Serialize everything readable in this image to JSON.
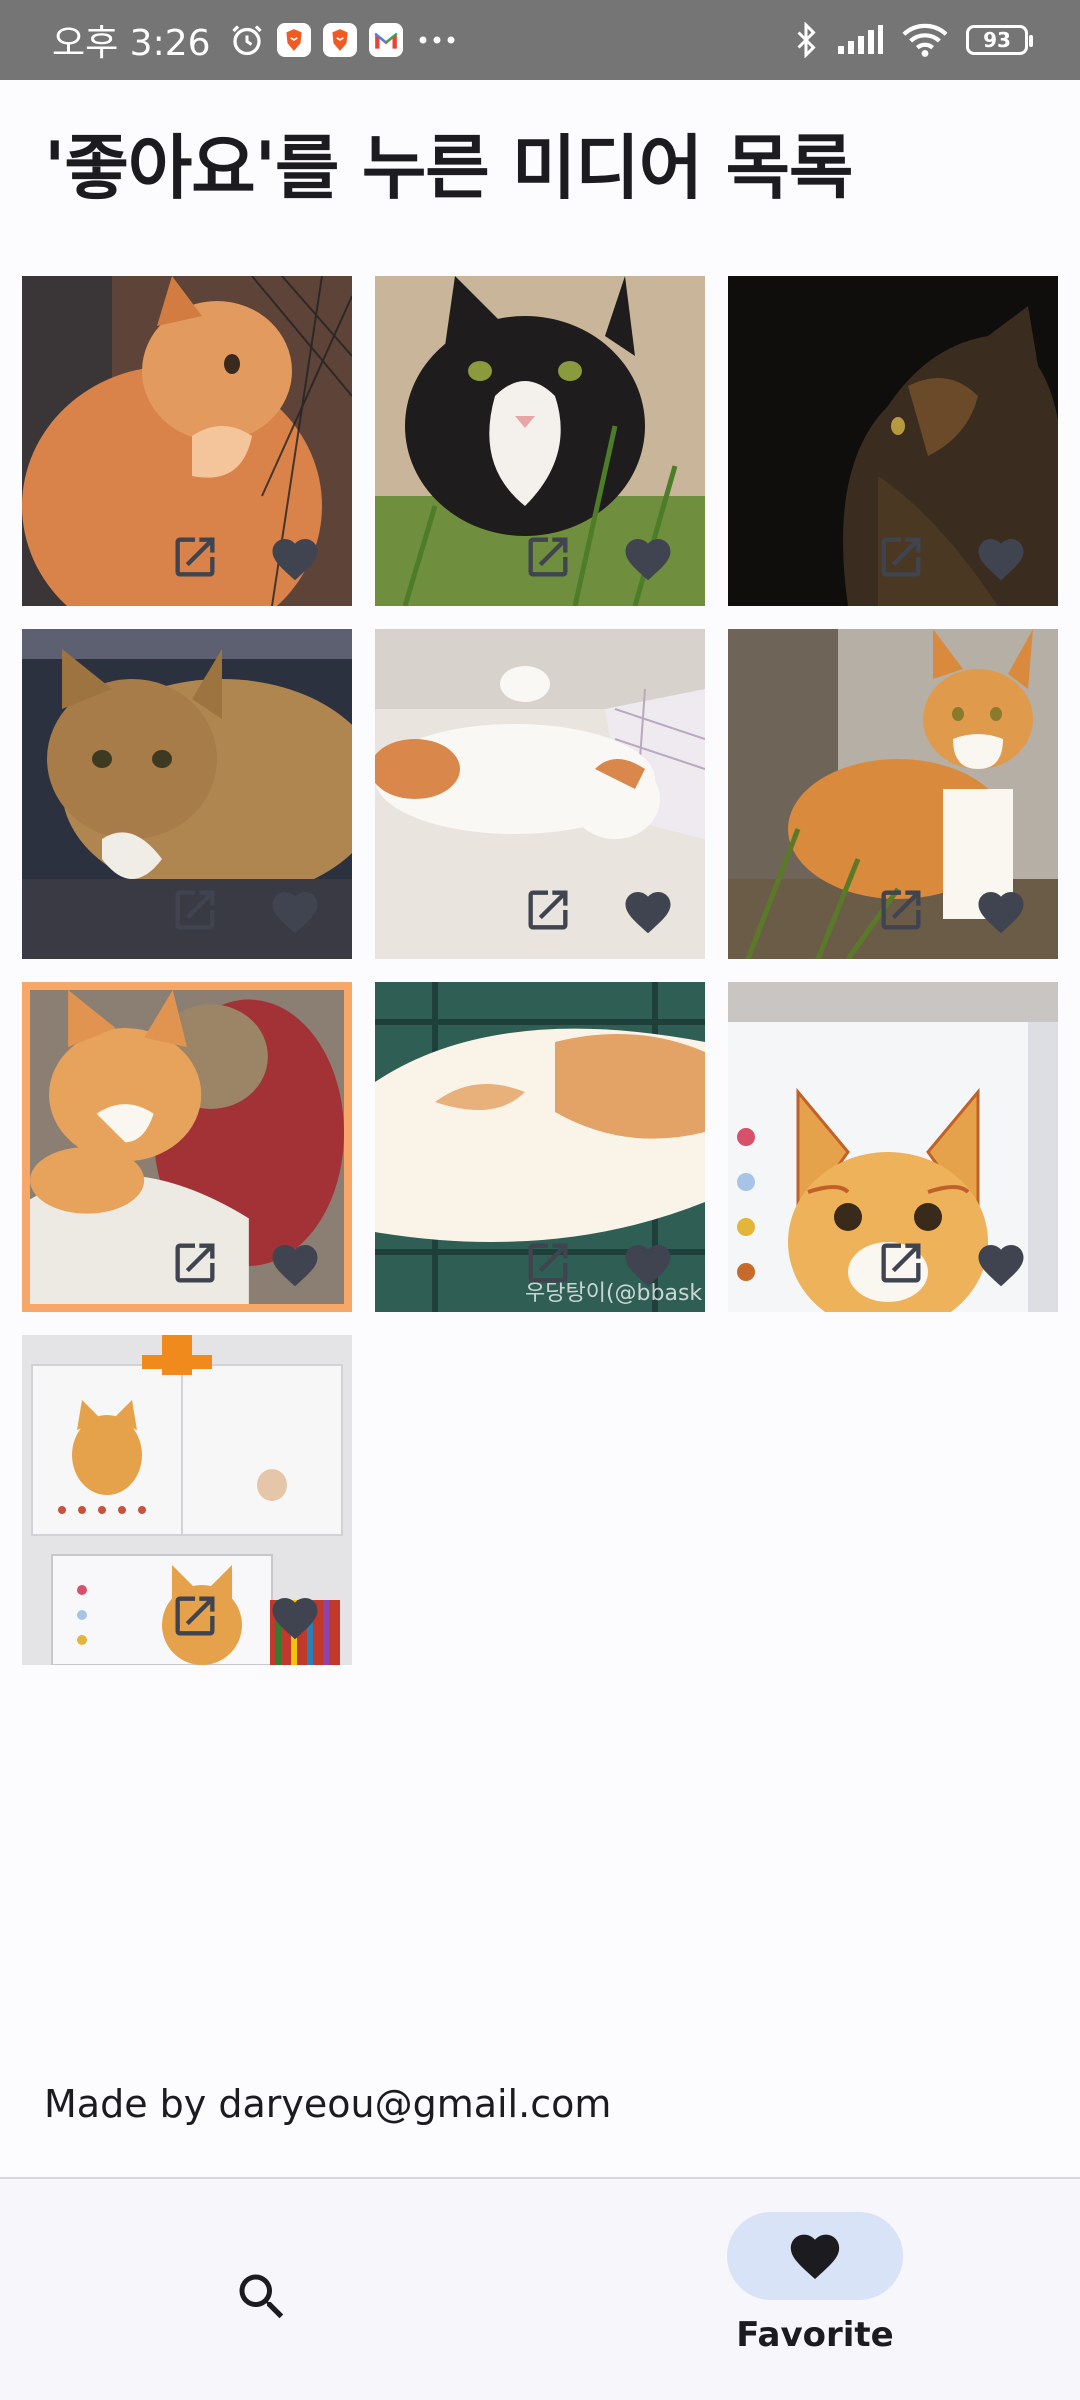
{
  "status_bar": {
    "time": "오후 3:26",
    "battery": "93",
    "icons": [
      "alarm-icon",
      "brave-icon",
      "brave-icon",
      "gmail-icon",
      "more-dots-icon",
      "bluetooth-icon",
      "signal-icon",
      "wifi-icon",
      "battery-icon"
    ]
  },
  "page": {
    "title": "'좋아요'를 누른 미디어 목록"
  },
  "grid": {
    "items": [
      {
        "subject": "orange cat at fence",
        "liked": true,
        "selected": false
      },
      {
        "subject": "black and white cat in grass",
        "liked": true,
        "selected": false
      },
      {
        "subject": "dark tabby cat profile",
        "liked": true,
        "selected": false
      },
      {
        "subject": "tabby cat on dark blanket",
        "liked": true,
        "selected": false
      },
      {
        "subject": "orange white cat sleeping on bed",
        "liked": true,
        "selected": false
      },
      {
        "subject": "orange white cat standing by tree",
        "liked": true,
        "selected": false
      },
      {
        "subject": "cat hugging plush toy",
        "liked": true,
        "selected": true
      },
      {
        "subject": "orange white cat on plaid blanket",
        "liked": true,
        "selected": false
      },
      {
        "subject": "cat painting",
        "liked": true,
        "selected": false
      },
      {
        "subject": "cat illustration book",
        "liked": true,
        "selected": false
      }
    ],
    "watermark_8": "우당탕이(@bbask"
  },
  "footer": {
    "credit": "Made by daryeou@gmail.com"
  },
  "bottom_nav": {
    "search_icon": "search-icon",
    "favorite_icon": "heart-icon",
    "favorite_label": "Favorite",
    "active_pill_color": "#D8E3F8"
  },
  "colors": {
    "selected_border": "#F7A868",
    "icon_overlay": "#3F4450",
    "status_bar_bg": "#757575"
  }
}
